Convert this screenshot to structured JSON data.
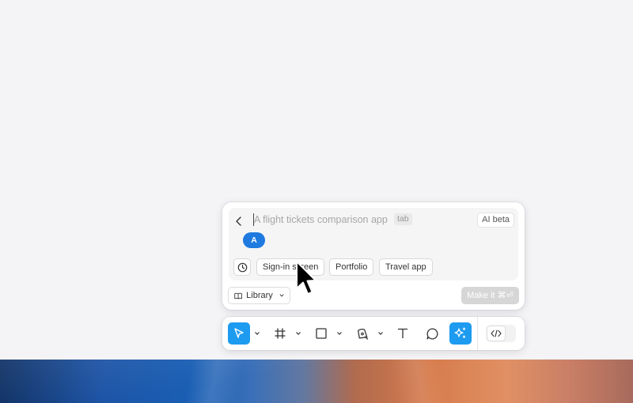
{
  "prompt": {
    "placeholder": "A flight tickets comparison app",
    "tab_hint": "tab",
    "ai_badge": "AI beta",
    "avatar_initial": "A",
    "suggestions": [
      "Sign-in screen",
      "Portfolio",
      "Travel app"
    ],
    "library_label": "Library",
    "make_label": "Make it ⌘⏎"
  },
  "toolbar": {
    "tools": [
      {
        "name": "move-tool",
        "icon": "cursor-arrow-icon",
        "active": true
      },
      {
        "name": "frame-tool",
        "icon": "hash-frame-icon",
        "active": false
      },
      {
        "name": "shape-tool",
        "icon": "square-icon",
        "active": false
      },
      {
        "name": "pen-tool",
        "icon": "pen-nib-icon",
        "active": false
      },
      {
        "name": "text-tool",
        "icon": "text-t-icon",
        "active": false
      },
      {
        "name": "comment-tool",
        "icon": "speech-bubble-icon",
        "active": false
      },
      {
        "name": "ai-tool",
        "icon": "sparkle-icon",
        "active": true
      }
    ],
    "dev_mode_icon": "code-brackets-icon"
  },
  "colors": {
    "accent": "#1d9bf0",
    "avatar": "#1f7ae0",
    "canvas": "#f4f3f6"
  }
}
